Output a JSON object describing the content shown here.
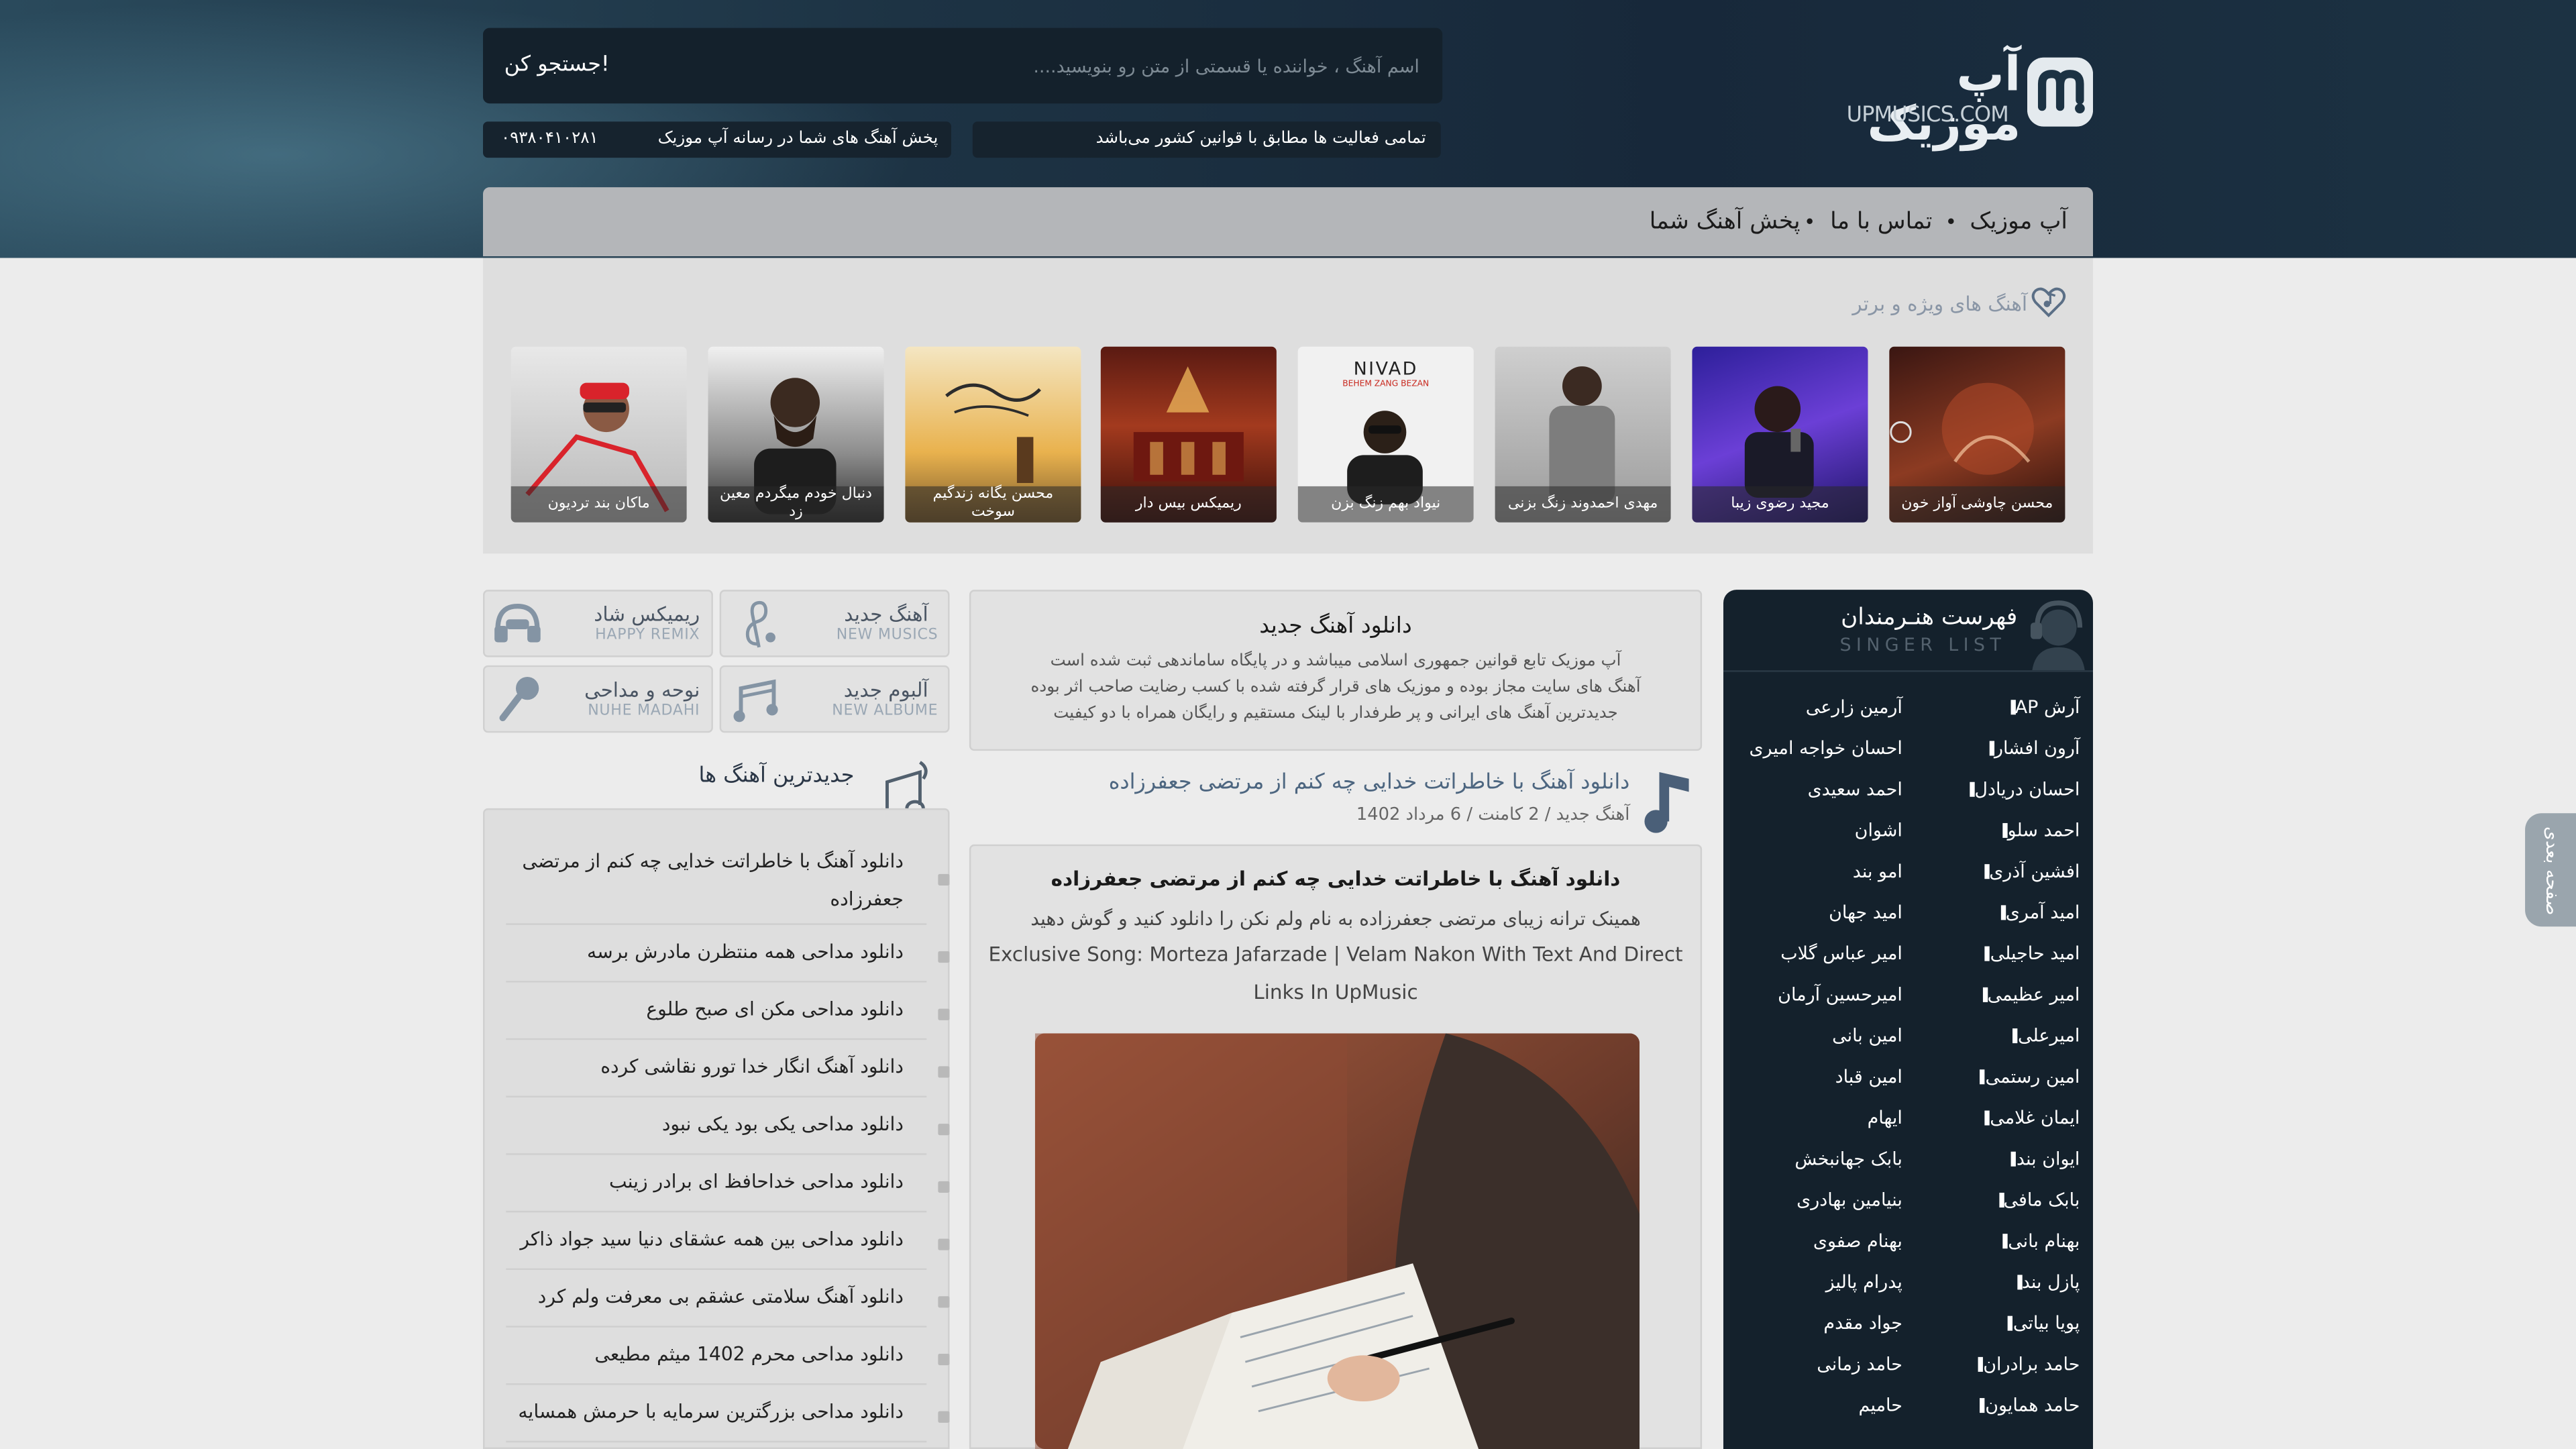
{
  "colors": {
    "header_dark": "#14212c",
    "accent_blue": "#4a5f78",
    "panel_gray": "#dedede"
  },
  "header": {
    "search_button": "جستجو کن!",
    "search_placeholder": "اسم آهنگ ، خواننده یا قسمتی از متن رو بنویسید....",
    "logo_fa": "آپ موزیک",
    "logo_en": "UPMUSICS.COM",
    "phone": "۰۹۳۸۰۴۱۰۲۸۱",
    "publish_notice": "پخش آهنگ های شما در رسانه آپ موزیک",
    "legal_notice": "تمامی فعالیت ها مطابق با قوانین کشور می‌باشد"
  },
  "nav": {
    "items": [
      "آپ موزیک",
      "تماس با ما",
      "پخش آهنگ شما"
    ]
  },
  "featured": {
    "title": "آهنگ های ویژه و برتر",
    "cards": [
      "محسن چاوشی آواز خون",
      "مجید رضوی زیبا",
      "مهدی احمدوند زنگ بزنی",
      "نیواد بهم زنگ بزن",
      "ریمیکس بیس دار",
      "محسن یگانه زندگیم سوخت",
      "دنبال خودم میگردم معین زد",
      "ماکان بند تردیون"
    ],
    "nivad_cover": {
      "name": "NIVAD",
      "sub": "BEHEM ZANG BEZAN"
    }
  },
  "categories": [
    {
      "title": "آهنگ جدید",
      "sub": "NEW MUSICS",
      "icon": "treble-clef-icon"
    },
    {
      "title": "ریمیکس شاد",
      "sub": "HAPPY REMIX",
      "icon": "dj-headphones-icon"
    },
    {
      "title": "آلبوم جدید",
      "sub": "NEW ALBUME",
      "icon": "album-notes-icon"
    },
    {
      "title": "نوحه و مداحی",
      "sub": "NUHE MADAHI",
      "icon": "microphone-icon"
    }
  ],
  "latest": {
    "title": "جدیدترین آهنگ ها",
    "items": [
      "دانلود آهنگ با خاطراتت خدایی چه کنم از مرتضی جعفرزاده",
      "دانلود مداحی همه منتظرن مادرش برسه",
      "دانلود مداحی مکن ای صبح طلوع",
      "دانلود آهنگ انگار خدا تورو نقاشی کرده",
      "دانلود مداحی یکی بود یکی نبود",
      "دانلود مداحی خداحافظ ای برادر زینب",
      "دانلود مداحی بین همه عشقای دنیا سید جواد ذاکر",
      "دانلود آهنگ سلامتی عشقم بی معرفت ولم کرد",
      "دانلود مداحی محرم 1402 میثم مطیعی",
      "دانلود مداحی بزرگترین سرمایه با حرمش همسایه"
    ]
  },
  "intro": {
    "title": "دانلود آهنگ جدید",
    "lines": [
      "آپ موزیک تابع قوانین جمهوری اسلامی میباشد و در پایگاه ساماندهی ثبت شده است",
      "آهنگ های سایت مجاز بوده و موزیک های قرار گرفته شده با کسب رضایت صاحب اثر بوده",
      "جدیدترین آهنگ های ایرانی و پر طرفدار با لینک مستقیم و رایگان همراه با دو کیفیت"
    ]
  },
  "post": {
    "title": "دانلود آهنگ با خاطراتت خدایی چه کنم از مرتضی جعفرزاده",
    "meta_category": "آهنگ جدید",
    "meta_comments": "2 کامنت",
    "meta_date": "6 مرداد 1402",
    "meta_sep": "/",
    "heading": "دانلود آهنگ با خاطراتت خدایی چه کنم از مرتضی جعفرزاده",
    "desc_fa": "همینک ترانه زیبای مرتضی جعفرزاده به نام ولم نکن را دانلود کنید و گوش دهید",
    "desc_en_1": "Exclusive Song: Morteza Jafarzade | Velam Nakon With Text And Direct",
    "desc_en_2": "Links In UpMusic"
  },
  "sidebar": {
    "title": "فهرست هنـرمندان",
    "subtitle": "SINGER LIST",
    "artists_right": [
      "آرش AP",
      "آرون افشار",
      "احسان دریادل",
      "احمد سلو",
      "افشین آذری",
      "امید آمری",
      "امید حاجیلی",
      "امیر عظیمی",
      "امیرعلی",
      "امین رستمی",
      "ایمان غلامی",
      "ایوان بند",
      "بابک مافی",
      "بهنام بانی",
      "پازل بند",
      "پویا بیاتی",
      "حامد برادران",
      "حامد همایون"
    ],
    "artists_left": [
      "آرمین زارعی",
      "احسان خواجه امیری",
      "احمد سعیدی",
      "اشوان",
      "امو بند",
      "امید جهان",
      "امیر عباس گلاب",
      "امیرحسین آرمان",
      "امین بانی",
      "امین قباد",
      "ایهام",
      "بابک جهانبخش",
      "بنیامین بهادری",
      "بهنام صفوی",
      "پدرام پالیز",
      "جواد مقدم",
      "حامد زمانی",
      "حامیم"
    ]
  },
  "next_page": "صفحه بعدی"
}
